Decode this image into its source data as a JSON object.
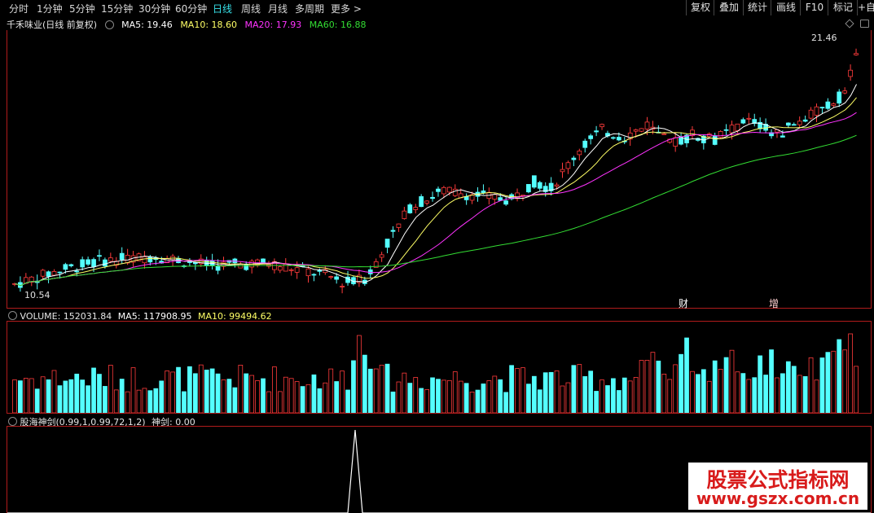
{
  "toolbar": {
    "periods": [
      "分时",
      "1分钟",
      "5分钟",
      "15分钟",
      "30分钟",
      "60分钟",
      "日线",
      "周线",
      "月线",
      "多周期",
      "更多 >"
    ],
    "active_period": "日线",
    "right_buttons": [
      "复权",
      "叠加",
      "统计",
      "画线",
      "F10",
      "标记",
      "+自"
    ]
  },
  "main_panel": {
    "stock_title": "千禾味业(日线 前复权)",
    "ma5": "MA5: 19.46",
    "ma10": "MA10: 18.60",
    "ma20": "MA20: 17.93",
    "ma60": "MA60: 16.88",
    "high_label": "21.46",
    "low_label": "10.54",
    "event_markers": [
      "财",
      "增"
    ]
  },
  "volume_panel": {
    "volume": "VOLUME: 152031.84",
    "ma5": "MA5: 117908.95",
    "ma10": "MA10: 99494.62"
  },
  "indicator_panel": {
    "name": "股海神剑(0.99,1,0.99,72,1,2)",
    "value": "神剑: 0.00"
  },
  "watermark": {
    "line1": "股票公式指标网",
    "line2": "www.gszx.com.cn"
  },
  "colors": {
    "up": "#ff3b3b",
    "down": "#54ffff",
    "ma5": "#ffffff",
    "ma10": "#ffff66",
    "ma20": "#ff33ff",
    "ma60": "#33dd33",
    "active_tab": "#37e0e8"
  }
}
